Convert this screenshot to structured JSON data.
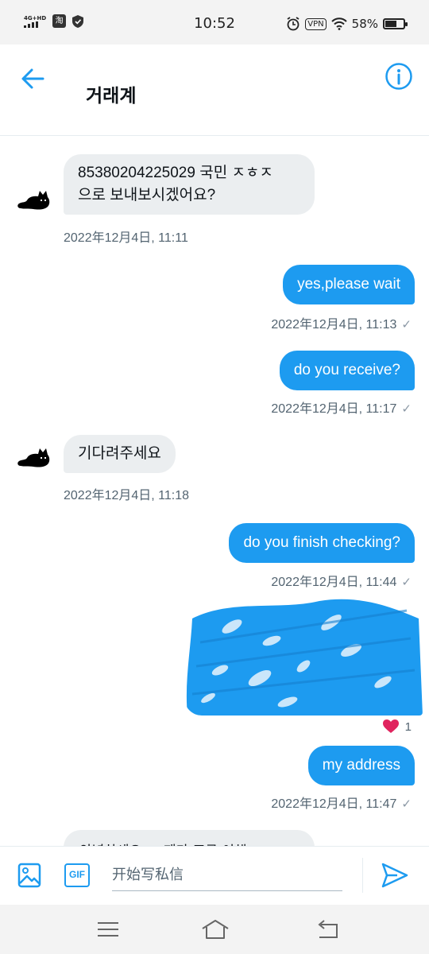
{
  "status_bar": {
    "network": "4G+HD",
    "time": "10:52",
    "vpn": "VPN",
    "battery": "58%",
    "battery_level": 0.58
  },
  "header": {
    "title": "거래계",
    "back_icon": "arrow-left-icon",
    "info_icon": "info-icon"
  },
  "messages": [
    {
      "side": "in",
      "text_line1": "85380204225029 국민 ㅈㅎㅈ",
      "text_line2": "으로 보내보시겠어요?",
      "time": "2022年12月4日, 11:11"
    },
    {
      "side": "out",
      "text": "yes,please wait",
      "time": "2022年12月4日, 11:13"
    },
    {
      "side": "out",
      "text": "do you receive?",
      "time": "2022年12月4日, 11:17"
    },
    {
      "side": "in",
      "text": "기다려주세요",
      "time": "2022年12月4日, 11:18"
    },
    {
      "side": "out",
      "text": "do you finish  checking?",
      "time": "2022年12月4日, 11:44"
    },
    {
      "side": "out",
      "type": "image",
      "reaction": "❤",
      "reaction_count": "1"
    },
    {
      "side": "out",
      "text": "my address",
      "time": "2022年12月4日, 11:47"
    }
  ],
  "partial_message": "안녕하세요 … 제가 조금 이해",
  "composer": {
    "placeholder": "开始写私信",
    "gif_label": "GIF"
  },
  "colors": {
    "accent": "#1d9bf0",
    "incoming_bubble": "#ebeef0",
    "timestamp": "#536471"
  }
}
